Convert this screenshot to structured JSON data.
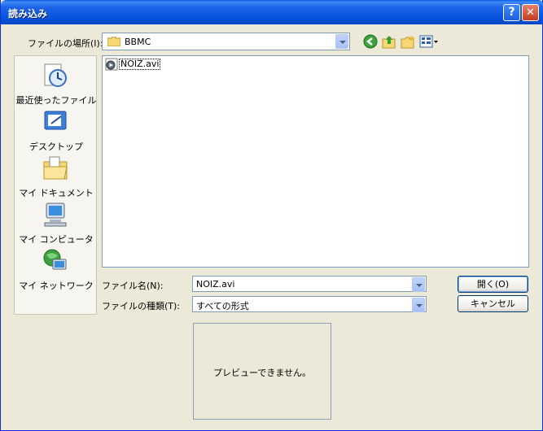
{
  "window": {
    "title": "読み込み",
    "help_glyph": "?",
    "close_glyph": "✕"
  },
  "lookin": {
    "label": "ファイルの場所(I):",
    "value": "BBMC"
  },
  "places": [
    {
      "label": "最近使ったファイル",
      "icon": "recent-documents-icon"
    },
    {
      "label": "デスクトップ",
      "icon": "desktop-icon"
    },
    {
      "label": "マイ ドキュメント",
      "icon": "my-documents-icon"
    },
    {
      "label": "マイ コンピュータ",
      "icon": "my-computer-icon"
    },
    {
      "label": "マイ ネットワーク",
      "icon": "my-network-icon"
    }
  ],
  "files": [
    {
      "name": "NOIZ.avi",
      "icon": "video-file-icon"
    }
  ],
  "filename": {
    "label": "ファイル名(N):",
    "value": "NOIZ.avi"
  },
  "filetype": {
    "label": "ファイルの種類(T):",
    "value": "すべての形式"
  },
  "buttons": {
    "open": "開く(O)",
    "cancel": "キャンセル"
  },
  "preview": {
    "message": "プレビューできません。"
  },
  "colors": {
    "titlebar": "#0855DD",
    "window_bg": "#ECE9D8",
    "border": "#7F9DB9"
  }
}
